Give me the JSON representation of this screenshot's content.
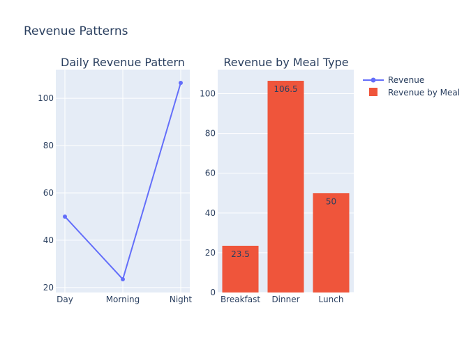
{
  "title": "Revenue Patterns",
  "colors": {
    "line": "#636efa",
    "bar": "#ef553b",
    "plot_bg": "#e5ecf6",
    "grid": "#ffffff",
    "text": "#2a3f5f"
  },
  "legend": {
    "placement": "top-right",
    "items": [
      {
        "label": "Revenue",
        "symbol": "line-marker"
      },
      {
        "label": "Revenue by Meal",
        "symbol": "square"
      }
    ]
  },
  "chart_data": [
    {
      "type": "line",
      "title": "Daily Revenue Pattern",
      "series": [
        {
          "name": "Revenue",
          "categories": [
            "Day",
            "Morning",
            "Night"
          ],
          "values": [
            50,
            23.5,
            106.5
          ]
        }
      ],
      "y_ticks": [
        20,
        40,
        60,
        80,
        100
      ],
      "ylim": [
        17.9,
        112.1
      ],
      "grid": true
    },
    {
      "type": "bar",
      "title": "Revenue by Meal Type",
      "series": [
        {
          "name": "Revenue by Meal",
          "categories": [
            "Breakfast",
            "Dinner",
            "Lunch"
          ],
          "values": [
            23.5,
            106.5,
            50
          ],
          "labels": [
            "23.5",
            "106.5",
            "50"
          ]
        }
      ],
      "y_ticks": [
        0,
        20,
        40,
        60,
        80,
        100
      ],
      "ylim": [
        0,
        112.1
      ],
      "grid": true
    }
  ]
}
